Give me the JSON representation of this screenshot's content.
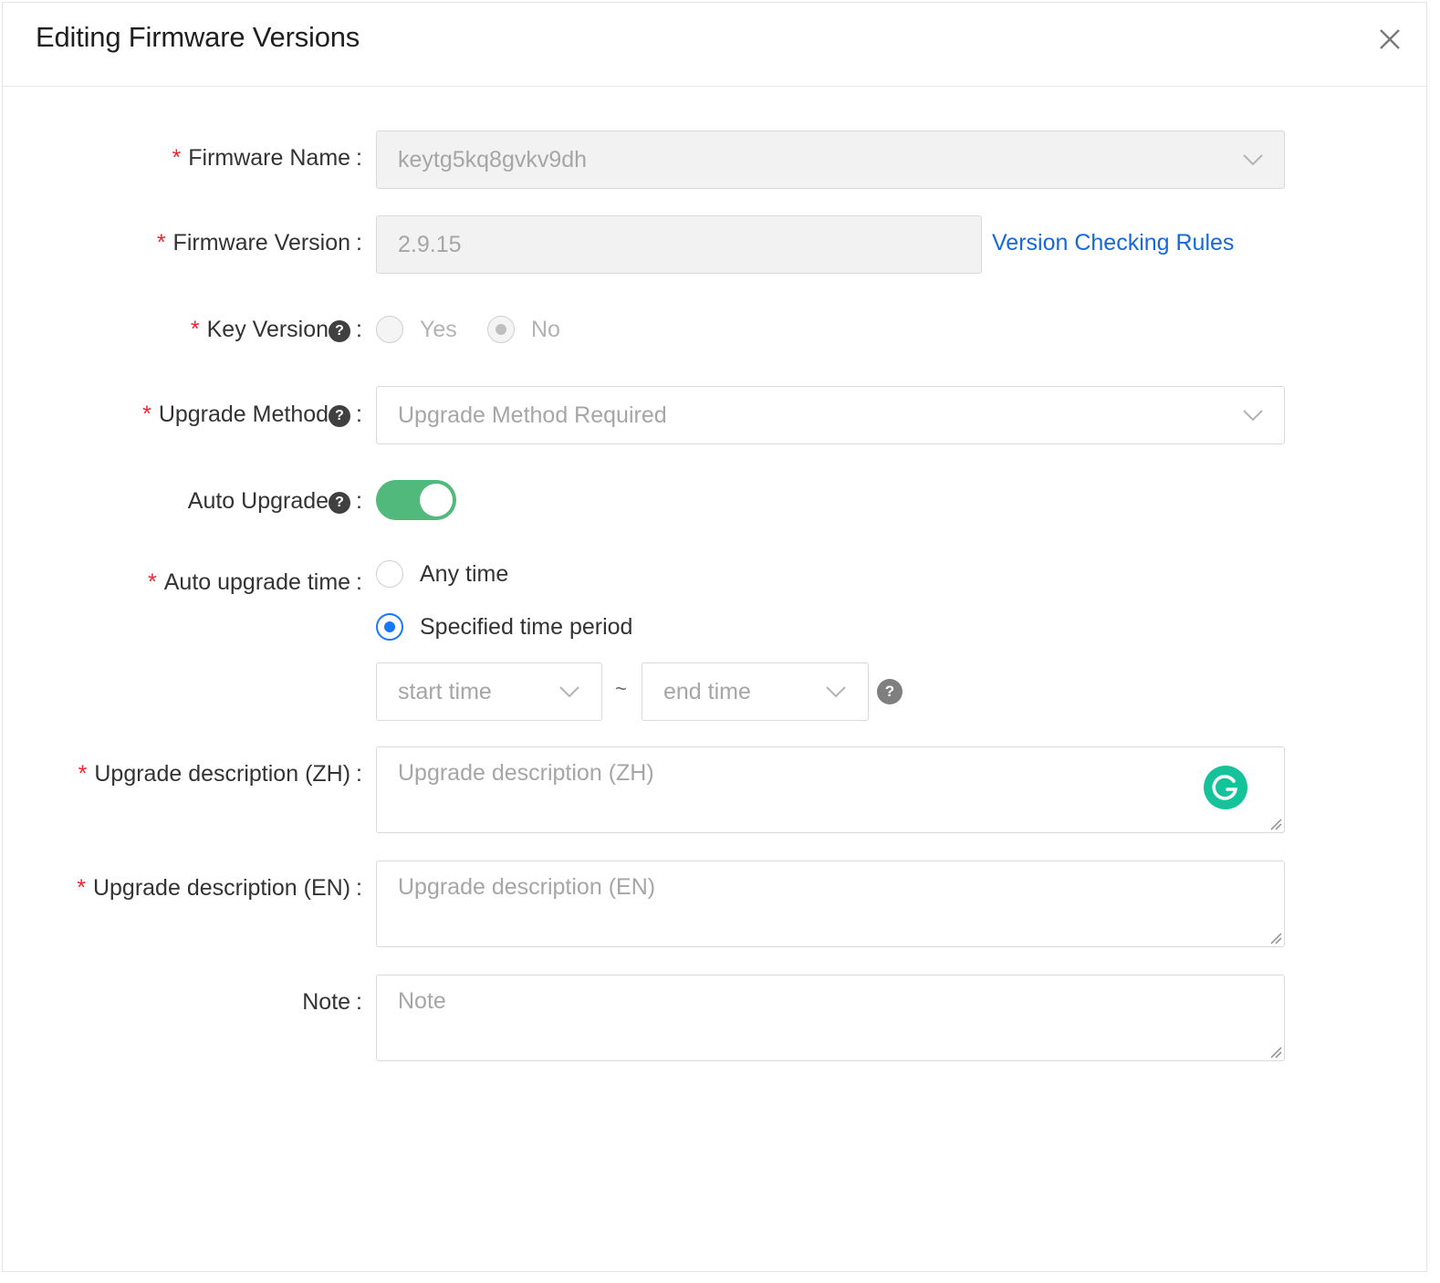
{
  "dialog": {
    "title": "Editing Firmware Versions"
  },
  "form": {
    "required_mark": "*",
    "colon": ":",
    "help_glyph": "?",
    "firmware_name": {
      "label": "Firmware Name",
      "value": "keytg5kq8gvkv9dh"
    },
    "firmware_version": {
      "label": "Firmware Version",
      "value": "2.9.15",
      "link": "Version Checking Rules"
    },
    "key_version": {
      "label": "Key Version",
      "options": [
        "Yes",
        "No"
      ],
      "selected": "No"
    },
    "upgrade_method": {
      "label": "Upgrade Method",
      "placeholder": "Upgrade Method Required"
    },
    "auto_upgrade": {
      "label": "Auto Upgrade",
      "enabled": true
    },
    "auto_upgrade_time": {
      "label": "Auto upgrade time",
      "options": [
        "Any time",
        "Specified time period"
      ],
      "selected": "Specified time period",
      "start_placeholder": "start time",
      "end_placeholder": "end time",
      "separator": "~"
    },
    "upgrade_desc_zh": {
      "label": "Upgrade description (ZH)",
      "placeholder": "Upgrade description (ZH)"
    },
    "upgrade_desc_en": {
      "label": "Upgrade description (EN)",
      "placeholder": "Upgrade description (EN)"
    },
    "note": {
      "label": "Note",
      "placeholder": "Note"
    }
  },
  "colors": {
    "accent": "#1677ff",
    "link": "#1668dc",
    "required": "#f5222d",
    "toggle_on": "#52b97c",
    "grammarly": "#15c39a"
  },
  "icons": {
    "close": "close-icon",
    "dropdown": "chevron-down-icon",
    "help": "question-circle-icon",
    "grammarly": "grammarly-icon",
    "resize": "resize-handle-icon"
  }
}
